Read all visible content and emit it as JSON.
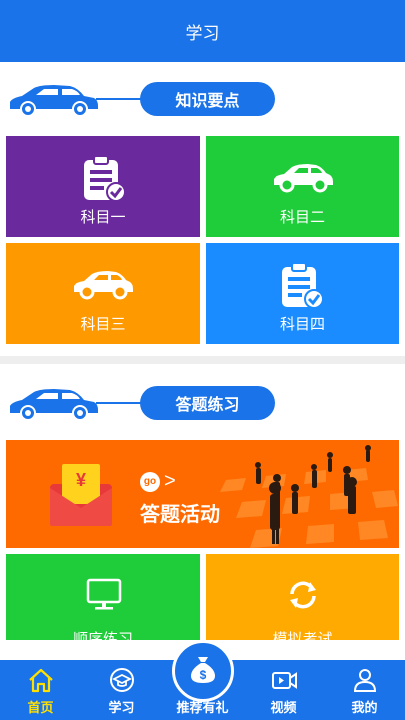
{
  "header": {
    "title": "学习"
  },
  "section1": {
    "pill": "知识要点"
  },
  "subjects": [
    {
      "label": "科目一",
      "color": "#6a2a9e",
      "icon": "clipboard-check-icon"
    },
    {
      "label": "科目二",
      "color": "#1fcc3a",
      "icon": "car-icon"
    },
    {
      "label": "科目三",
      "color": "#ff9900",
      "icon": "car-icon"
    },
    {
      "label": "科目四",
      "color": "#1a8cff",
      "icon": "clipboard-check-icon"
    }
  ],
  "section2": {
    "pill": "答题练习"
  },
  "banner": {
    "go_text": "go",
    "arrow": ">",
    "title": "答题活动",
    "yen": "¥",
    "color": "#ff6a00"
  },
  "practice": [
    {
      "label": "顺序练习",
      "color": "#1fcc3a",
      "icon": "monitor-icon"
    },
    {
      "label": "模拟考试",
      "color": "#ffaa00",
      "icon": "refresh-icon"
    }
  ],
  "nav": [
    {
      "label": "首页",
      "icon": "home-icon",
      "active": true
    },
    {
      "label": "学习",
      "icon": "graduation-icon",
      "active": false
    },
    {
      "label": "推荐有礼",
      "icon": "money-bag-icon",
      "active": false
    },
    {
      "label": "视频",
      "icon": "video-icon",
      "active": false
    },
    {
      "label": "我的",
      "icon": "user-icon",
      "active": false
    }
  ]
}
